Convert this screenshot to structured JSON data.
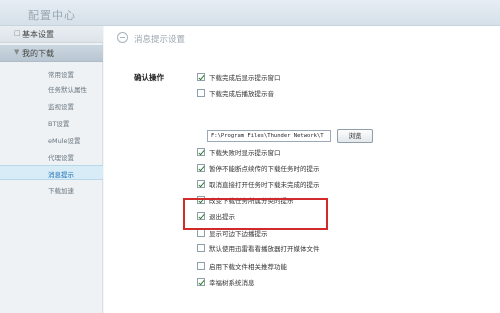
{
  "app": {
    "title": "配置中心"
  },
  "sidebar": {
    "sections": [
      {
        "label": "基本设置",
        "mark": "□"
      },
      {
        "label": "我的下载",
        "mark": "▼"
      }
    ],
    "items": [
      {
        "label": "常用设置"
      },
      {
        "label": "任务默认属性"
      },
      {
        "label": "监视设置"
      },
      {
        "label": "BT设置"
      },
      {
        "label": "eMule设置"
      },
      {
        "label": "代理设置"
      },
      {
        "label": "消息提示"
      },
      {
        "label": "下载加速"
      }
    ]
  },
  "content": {
    "header_title": "消息提示设置",
    "group_label": "确认操作",
    "path_value": "F:\\Program Files\\Thunder Network\\T",
    "browse_label": "浏览",
    "options": [
      {
        "label": "下载完成后显示提示窗口",
        "checked": true
      },
      {
        "label": "下载完成后播放提示音",
        "checked": false
      },
      {
        "label": "下载失败时显示提示窗口",
        "checked": true
      },
      {
        "label": "暂停不能断点续传的下载任务时的提示",
        "checked": true
      },
      {
        "label": "取消直接打开任务时下载未完成的提示",
        "checked": true
      },
      {
        "label": "改变下载任务所属分类的提示",
        "checked": true
      },
      {
        "label": "退出提示",
        "checked": true
      },
      {
        "label": "显示可边下边播提示",
        "checked": false
      },
      {
        "label": "默认使用迅雷看看播放器打开媒体文件",
        "checked": false
      },
      {
        "label": "启用下载文件相关推荐功能",
        "checked": false
      },
      {
        "label": "幸福树系统消息",
        "checked": true
      }
    ]
  }
}
